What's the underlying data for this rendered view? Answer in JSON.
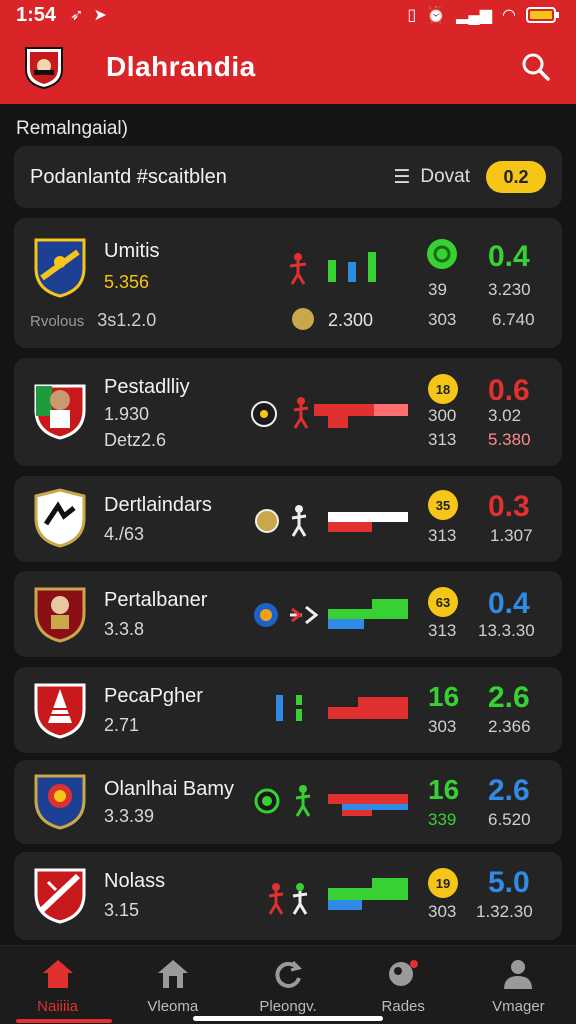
{
  "status": {
    "time": "1:54"
  },
  "app": {
    "title": "Dlahrandia"
  },
  "section": {
    "label": "Remalngaial)"
  },
  "filter": {
    "title": "Podanlantd #scaitblen",
    "sort_label": "Dovat",
    "pill": "0.2"
  },
  "teams": [
    {
      "name": "Umitis",
      "line2": "5.356",
      "line3_prefix": "Rvolous",
      "line3": "3s1.2.0",
      "mid_value": "2.300",
      "badge": "",
      "stat_a1": "39",
      "stat_a2": "303",
      "score": "0.4",
      "stat_b1": "3.230",
      "stat_b2": "6.740"
    },
    {
      "name": "Pestadlliy",
      "line2": "1.930",
      "line3": "Detz2.6",
      "badge": "18",
      "stat_a1": "300",
      "stat_a2": "313",
      "score": "0.6",
      "stat_b1": "3.02",
      "stat_b2": "5.380"
    },
    {
      "name": "Dertlaindars",
      "line2": "4./63",
      "badge": "35",
      "stat_a1": "313",
      "score": "0.3",
      "stat_b1": "1.307"
    },
    {
      "name": "Pertalbaner",
      "line2": "3.3.8",
      "badge": "63",
      "stat_a1": "313",
      "score": "0.4",
      "stat_b1": "13.3.30"
    },
    {
      "name": "PecaPgher",
      "line2": "2.71",
      "score_a": "16",
      "stat_a1": "303",
      "score": "2.6",
      "stat_b1": "2.366"
    },
    {
      "name": "Olanlhai Bamy",
      "line2": "3.3.39",
      "score_a": "16",
      "stat_a1": "339",
      "score": "2.6",
      "stat_b1": "6.520"
    },
    {
      "name": "Nolass",
      "line2": "3.15",
      "badge": "19",
      "stat_a1": "303",
      "score": "5.0",
      "stat_b1": "1.32.30"
    }
  ],
  "nav": [
    {
      "label": "Naiiiia",
      "icon": "home-icon"
    },
    {
      "label": "Vleoma",
      "icon": "stadium-icon"
    },
    {
      "label": "Pleongv.",
      "icon": "refresh-icon"
    },
    {
      "label": "Rades",
      "icon": "ball-player-icon"
    },
    {
      "label": "Vmager",
      "icon": "user-icon"
    }
  ],
  "colors": {
    "brand": "#d92428",
    "green": "#38d133",
    "red": "#e0302f",
    "blue": "#2f8be6",
    "yellow": "#f5c518"
  }
}
